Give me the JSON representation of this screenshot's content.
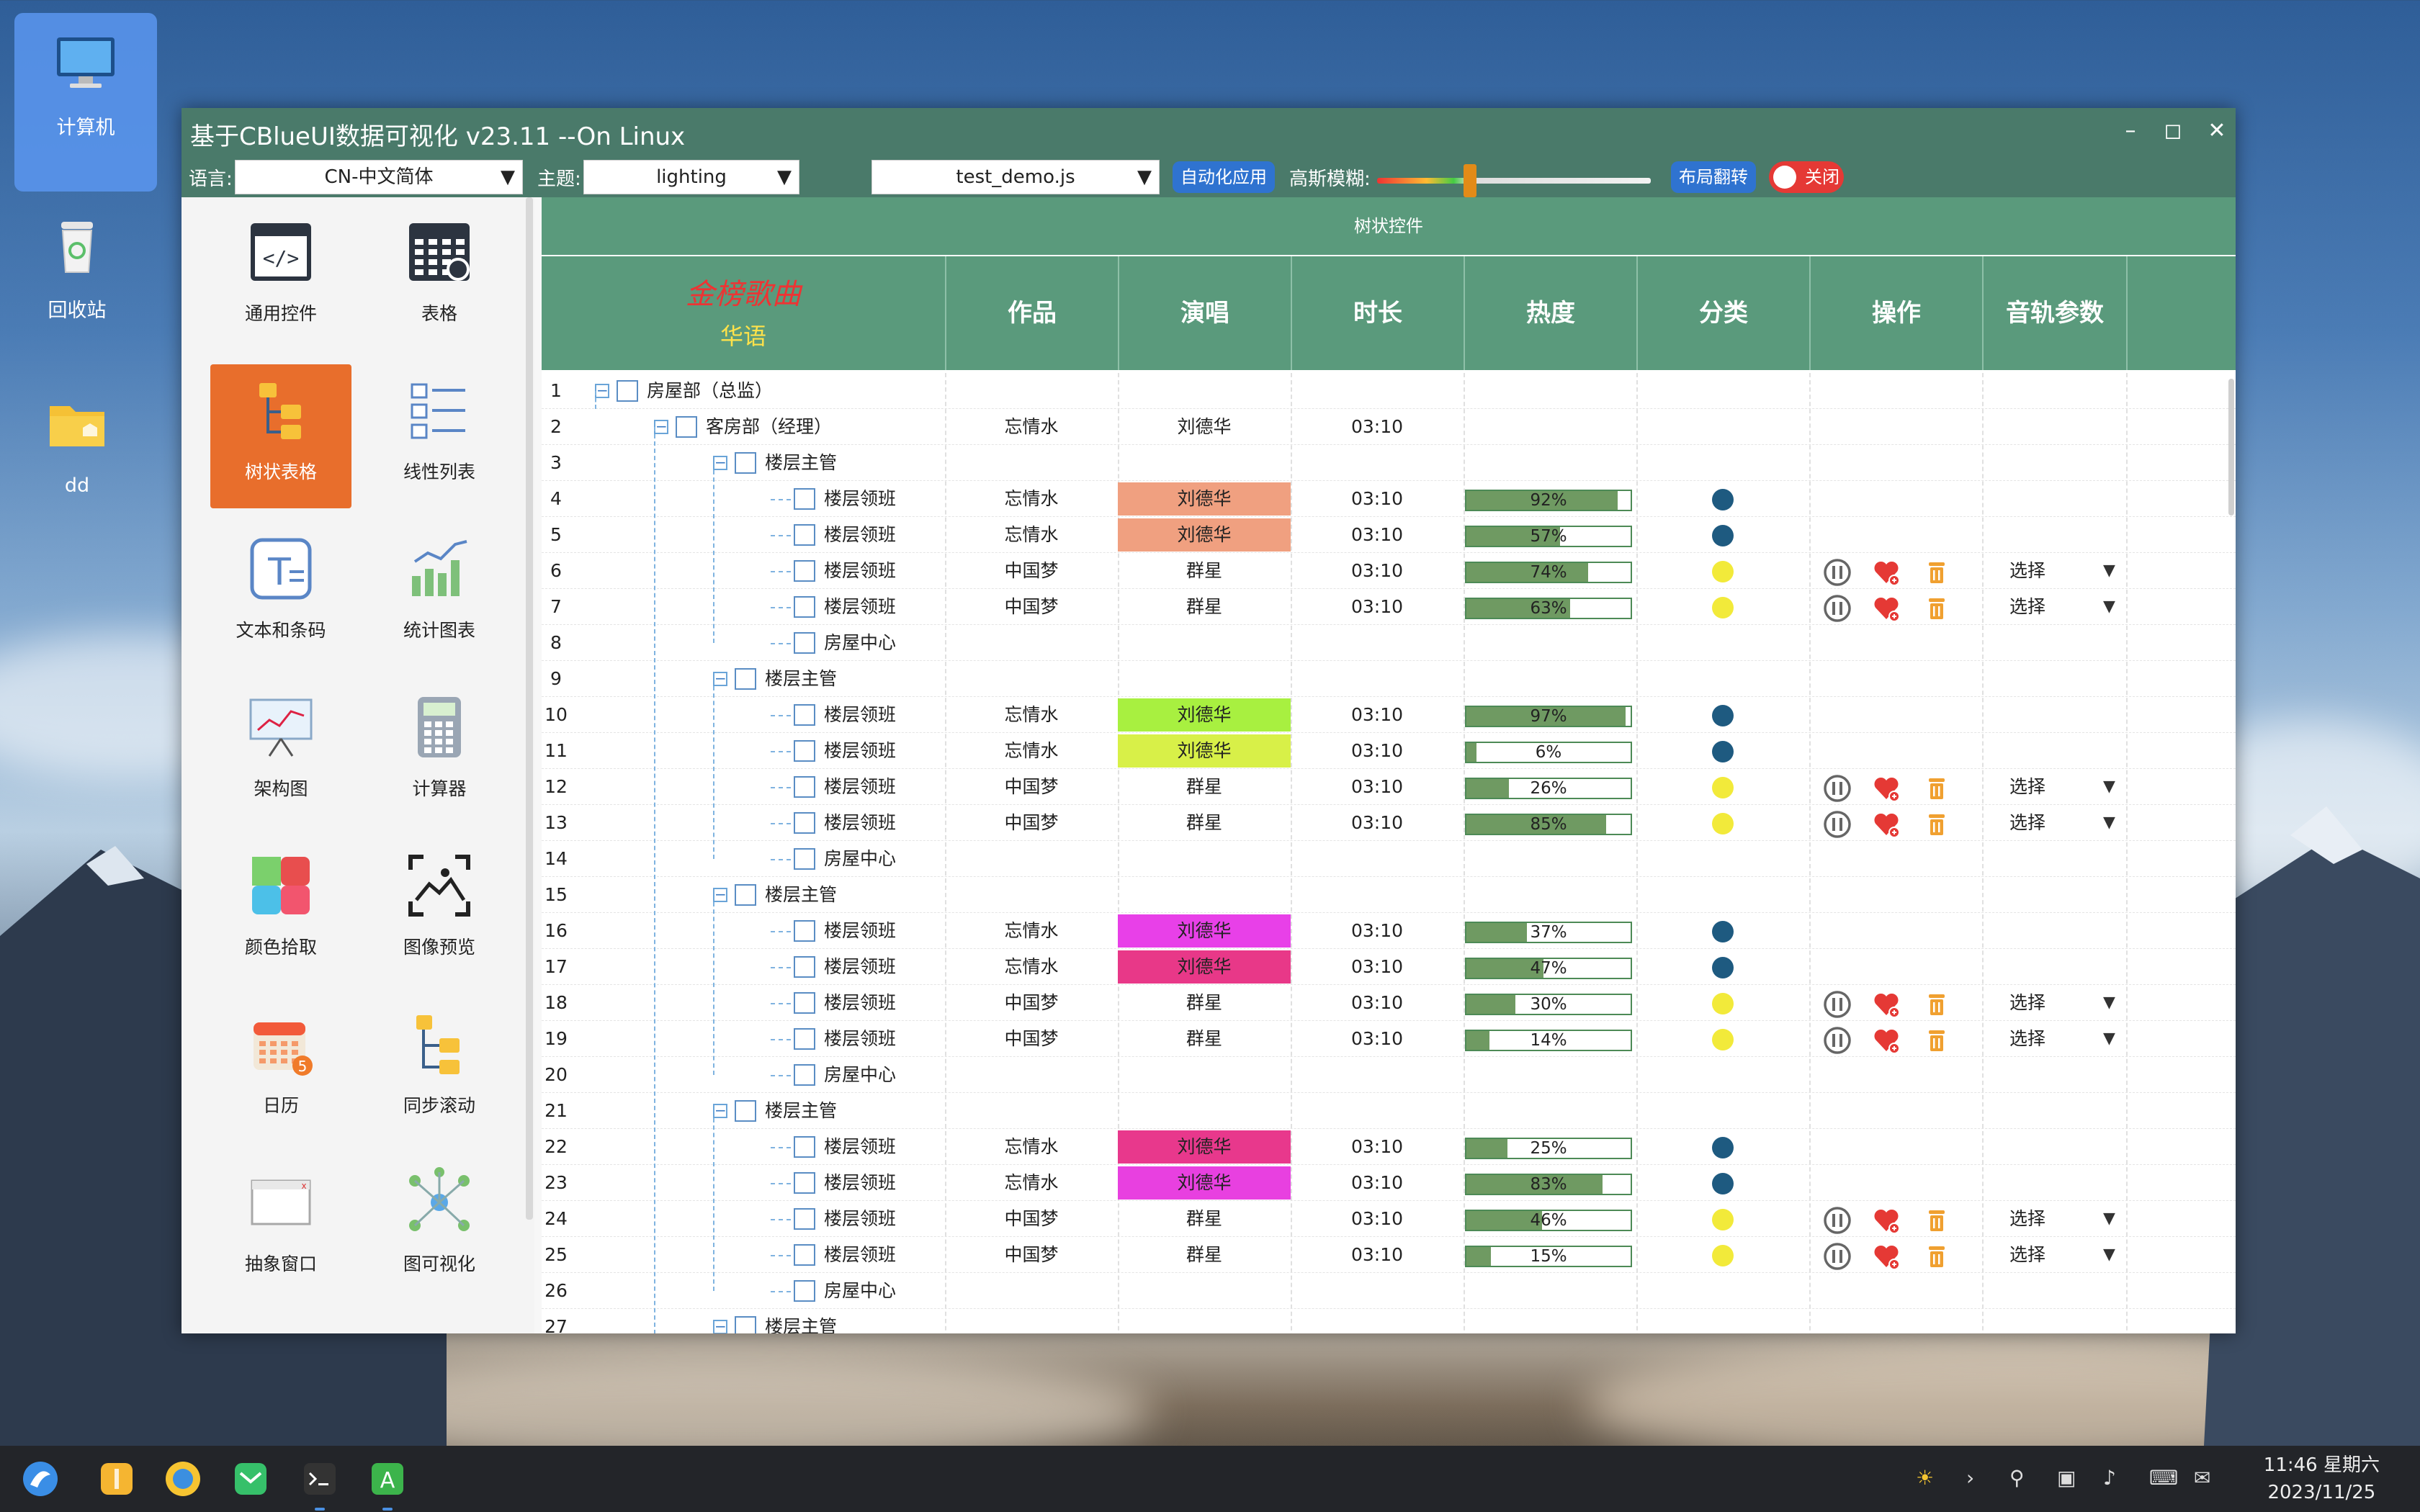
{
  "desktop": {
    "icons": [
      {
        "label": "计算机"
      },
      {
        "label": "回收站"
      },
      {
        "label": "dd"
      }
    ]
  },
  "window": {
    "title": "基于CBlueUI数据可视化 v23.11 --On Linux",
    "toolbar": {
      "language_label": "语言:",
      "language_value": "CN-中文简体",
      "theme_label": "主题:",
      "theme_value": "lighting",
      "script_value": "test_demo.js",
      "auto_apply_label": "自动化应用",
      "blur_label": "高斯模糊:",
      "blur_level": 0.34,
      "layout_flip_label": "布局翻转",
      "toggle_label": "关闭"
    },
    "sidebar": {
      "items": [
        {
          "label": "通用控件"
        },
        {
          "label": "表格"
        },
        {
          "label": "树状表格"
        },
        {
          "label": "线性列表"
        },
        {
          "label": "文本和条码"
        },
        {
          "label": "统计图表"
        },
        {
          "label": "架构图"
        },
        {
          "label": "计算器"
        },
        {
          "label": "颜色拾取"
        },
        {
          "label": "图像预览"
        },
        {
          "label": "日历"
        },
        {
          "label": "同步滚动"
        },
        {
          "label": "抽象窗口"
        },
        {
          "label": "图可视化"
        }
      ],
      "active_index": 2
    },
    "table": {
      "caption": "树状控件",
      "header_title": "金榜歌曲",
      "header_subtitle": "华语",
      "columns": [
        "作品",
        "演唱",
        "时长",
        "热度",
        "分类",
        "操作",
        "音轨参数"
      ],
      "select_label": "选择",
      "rows": [
        {
          "n": "1",
          "level": 0,
          "node": "group",
          "name": "房屋部（总监）"
        },
        {
          "n": "2",
          "level": 1,
          "node": "group",
          "name": "客房部（经理）",
          "work": "忘情水",
          "singer": "刘德华",
          "duration": "03:10"
        },
        {
          "n": "3",
          "level": 2,
          "node": "group",
          "name": "楼层主管"
        },
        {
          "n": "4",
          "level": 3,
          "node": "leaf",
          "name": "楼层领班",
          "work": "忘情水",
          "singer": "刘德华",
          "singer_bg": "#f0a080",
          "duration": "03:10",
          "heat": 92,
          "heat_text": "92%",
          "category_color": "#1e5a80"
        },
        {
          "n": "5",
          "level": 3,
          "node": "leaf",
          "name": "楼层领班",
          "work": "忘情水",
          "singer": "刘德华",
          "singer_bg": "#f0a080",
          "duration": "03:10",
          "heat": 57,
          "heat_text": "57%",
          "category_color": "#1e5a80"
        },
        {
          "n": "6",
          "level": 3,
          "node": "leaf",
          "name": "楼层领班",
          "work": "中国梦",
          "singer": "群星",
          "duration": "03:10",
          "heat": 74,
          "heat_text": "74%",
          "category_color": "#f2ea3a",
          "ops": true
        },
        {
          "n": "7",
          "level": 3,
          "node": "leaf",
          "name": "楼层领班",
          "work": "中国梦",
          "singer": "群星",
          "duration": "03:10",
          "heat": 63,
          "heat_text": "63%",
          "category_color": "#f2ea3a",
          "ops": true
        },
        {
          "n": "8",
          "level": 3,
          "node": "leaf-last",
          "name": "房屋中心"
        },
        {
          "n": "9",
          "level": 2,
          "node": "group",
          "name": "楼层主管"
        },
        {
          "n": "10",
          "level": 3,
          "node": "leaf",
          "name": "楼层领班",
          "work": "忘情水",
          "singer": "刘德华",
          "singer_bg": "#a8f040",
          "duration": "03:10",
          "heat": 97,
          "heat_text": "97%",
          "category_color": "#1e5a80"
        },
        {
          "n": "11",
          "level": 3,
          "node": "leaf",
          "name": "楼层领班",
          "work": "忘情水",
          "singer": "刘德华",
          "singer_bg": "#d8f048",
          "duration": "03:10",
          "heat": 6,
          "heat_text": "6%",
          "category_color": "#1e5a80"
        },
        {
          "n": "12",
          "level": 3,
          "node": "leaf",
          "name": "楼层领班",
          "work": "中国梦",
          "singer": "群星",
          "duration": "03:10",
          "heat": 26,
          "heat_text": "26%",
          "category_color": "#f2ea3a",
          "ops": true
        },
        {
          "n": "13",
          "level": 3,
          "node": "leaf",
          "name": "楼层领班",
          "work": "中国梦",
          "singer": "群星",
          "duration": "03:10",
          "heat": 85,
          "heat_text": "85%",
          "category_color": "#f2ea3a",
          "ops": true
        },
        {
          "n": "14",
          "level": 3,
          "node": "leaf-last",
          "name": "房屋中心"
        },
        {
          "n": "15",
          "level": 2,
          "node": "group",
          "name": "楼层主管"
        },
        {
          "n": "16",
          "level": 3,
          "node": "leaf",
          "name": "楼层领班",
          "work": "忘情水",
          "singer": "刘德华",
          "singer_bg": "#e840e8",
          "duration": "03:10",
          "heat": 37,
          "heat_text": "37%",
          "category_color": "#1e5a80"
        },
        {
          "n": "17",
          "level": 3,
          "node": "leaf",
          "name": "楼层领班",
          "work": "忘情水",
          "singer": "刘德华",
          "singer_bg": "#e83888",
          "duration": "03:10",
          "heat": 47,
          "heat_text": "47%",
          "category_color": "#1e5a80"
        },
        {
          "n": "18",
          "level": 3,
          "node": "leaf",
          "name": "楼层领班",
          "work": "中国梦",
          "singer": "群星",
          "duration": "03:10",
          "heat": 30,
          "heat_text": "30%",
          "category_color": "#f2ea3a",
          "ops": true
        },
        {
          "n": "19",
          "level": 3,
          "node": "leaf",
          "name": "楼层领班",
          "work": "中国梦",
          "singer": "群星",
          "duration": "03:10",
          "heat": 14,
          "heat_text": "14%",
          "category_color": "#f2ea3a",
          "ops": true
        },
        {
          "n": "20",
          "level": 3,
          "node": "leaf-last",
          "name": "房屋中心"
        },
        {
          "n": "21",
          "level": 2,
          "node": "group",
          "name": "楼层主管"
        },
        {
          "n": "22",
          "level": 3,
          "node": "leaf",
          "name": "楼层领班",
          "work": "忘情水",
          "singer": "刘德华",
          "singer_bg": "#e8388c",
          "duration": "03:10",
          "heat": 25,
          "heat_text": "25%",
          "category_color": "#1e5a80"
        },
        {
          "n": "23",
          "level": 3,
          "node": "leaf",
          "name": "楼层领班",
          "work": "忘情水",
          "singer": "刘德华",
          "singer_bg": "#e840e0",
          "duration": "03:10",
          "heat": 83,
          "heat_text": "83%",
          "category_color": "#1e5a80"
        },
        {
          "n": "24",
          "level": 3,
          "node": "leaf",
          "name": "楼层领班",
          "work": "中国梦",
          "singer": "群星",
          "duration": "03:10",
          "heat": 46,
          "heat_text": "46%",
          "category_color": "#f2ea3a",
          "ops": true
        },
        {
          "n": "25",
          "level": 3,
          "node": "leaf",
          "name": "楼层领班",
          "work": "中国梦",
          "singer": "群星",
          "duration": "03:10",
          "heat": 15,
          "heat_text": "15%",
          "category_color": "#f2ea3a",
          "ops": true
        },
        {
          "n": "26",
          "level": 3,
          "node": "leaf-last",
          "name": "房屋中心"
        },
        {
          "n": "27",
          "level": 2,
          "node": "group",
          "name": "楼层主管"
        }
      ]
    }
  },
  "taskbar": {
    "clock_time": "11:46 星期六",
    "clock_date": "2023/11/25"
  }
}
